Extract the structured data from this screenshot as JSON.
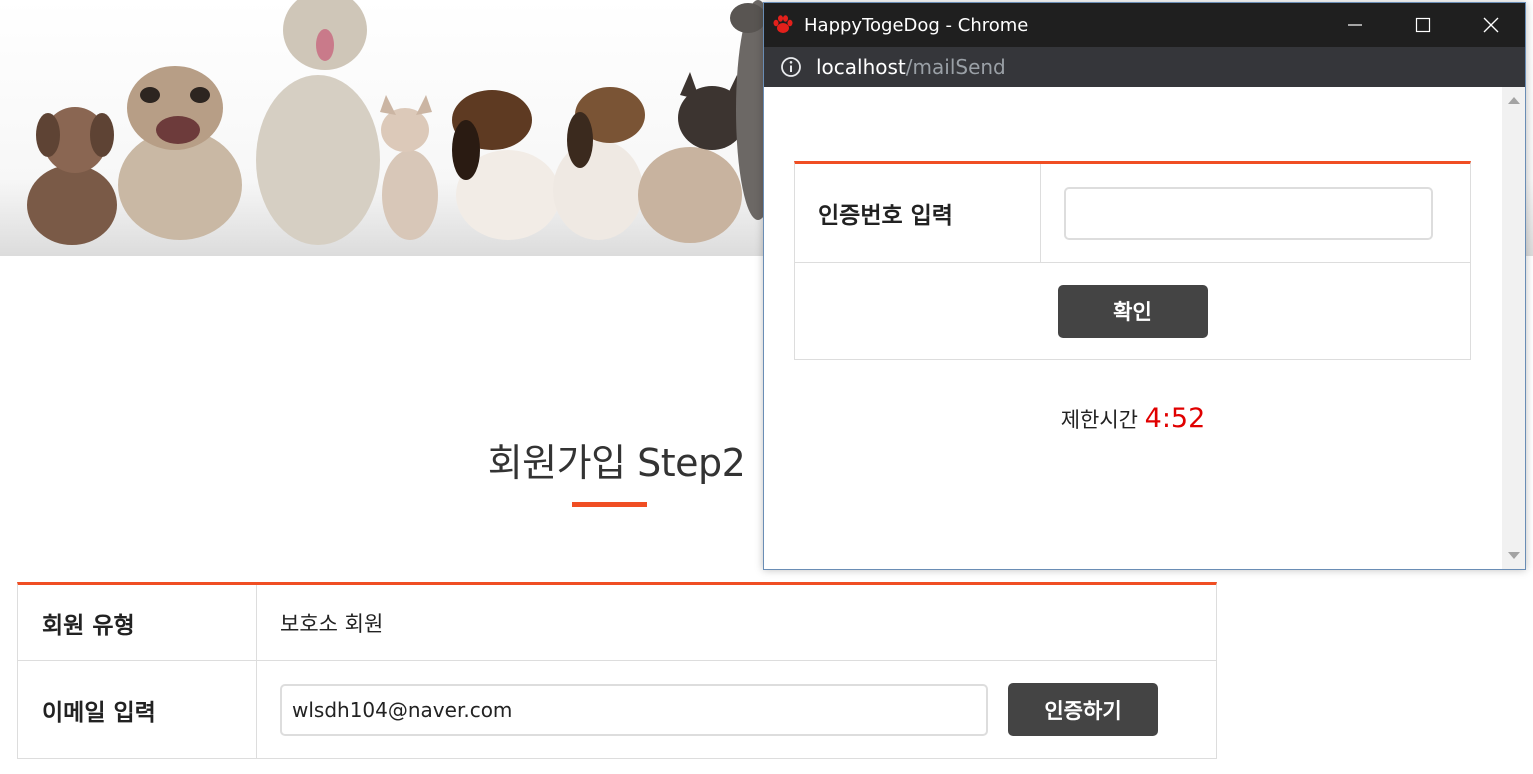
{
  "page": {
    "title": "회원가입 Step2",
    "table": {
      "member_type_label": "회원 유형",
      "member_type_value": "보호소 회원",
      "email_label": "이메일 입력",
      "email_value": "wlsdh104@naver.com",
      "verify_button": "인증하기"
    }
  },
  "popup": {
    "window_title": "HappyTogeDog - Chrome",
    "url_host": "localhost",
    "url_path": "/mailSend",
    "code_label": "인증번호 입력",
    "code_value": "",
    "confirm_button": "확인",
    "timer_label": "제한시간",
    "timer_value": "4:52"
  },
  "colors": {
    "accent": "#f04e23",
    "button": "#444444",
    "timer": "#e00000",
    "titlebar": "#1f1f1f"
  },
  "icons": [
    "paw-icon",
    "minimize-icon",
    "maximize-icon",
    "close-icon",
    "info-icon",
    "scroll-up-arrow",
    "scroll-down-arrow"
  ]
}
